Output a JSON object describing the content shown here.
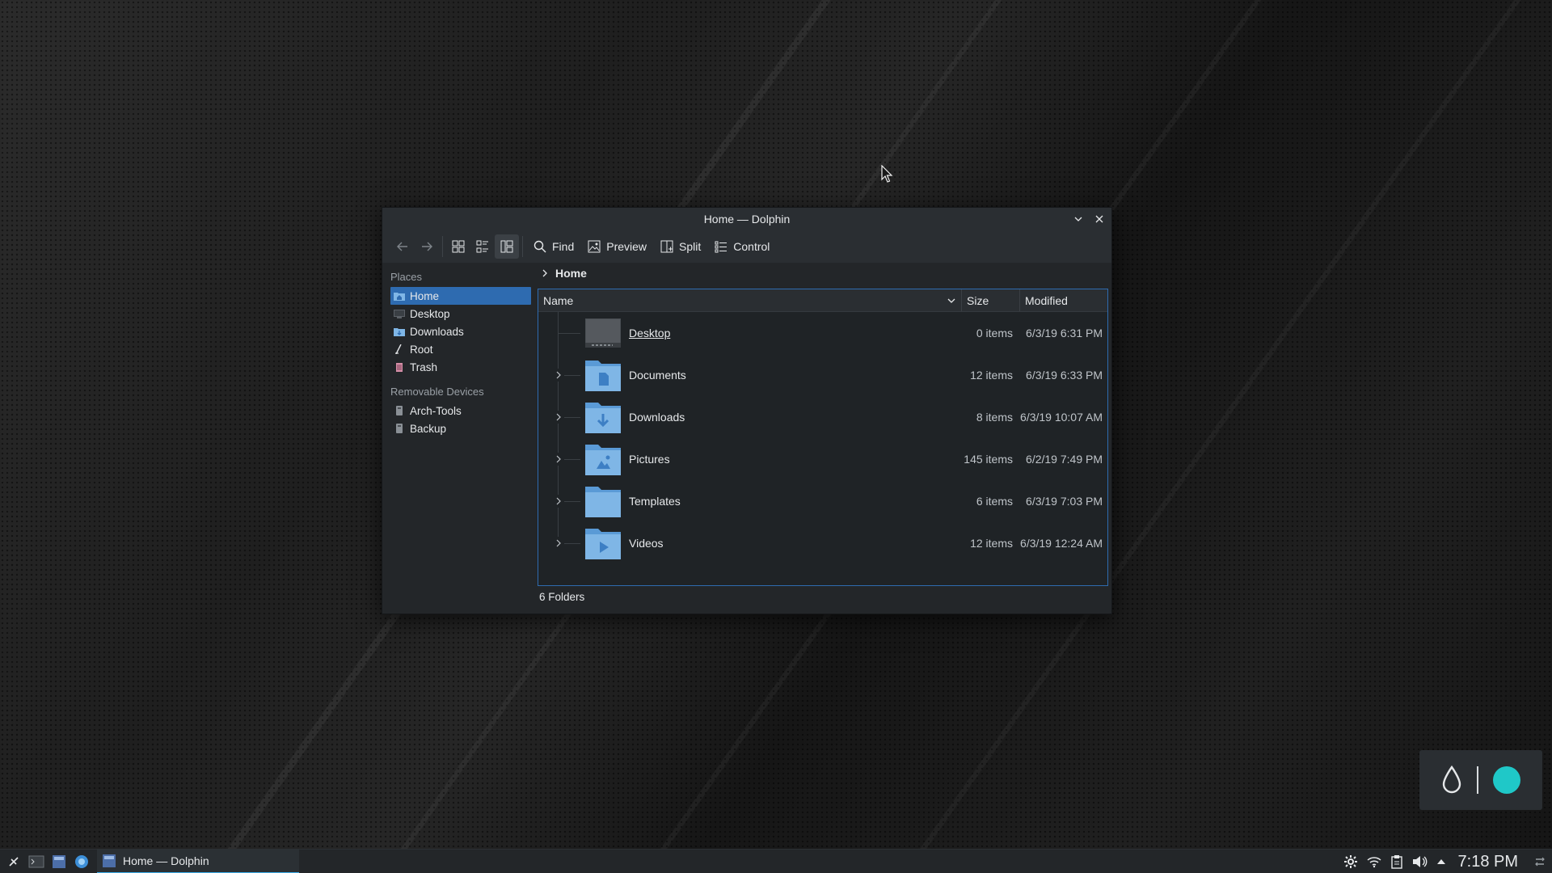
{
  "window": {
    "title": "Home — Dolphin"
  },
  "toolbar": {
    "find_label": "Find",
    "preview_label": "Preview",
    "split_label": "Split",
    "control_label": "Control"
  },
  "sidebar": {
    "places_title": "Places",
    "places": [
      {
        "label": "Home",
        "icon": "home-folder-icon",
        "selected": true
      },
      {
        "label": "Desktop",
        "icon": "desktop-icon"
      },
      {
        "label": "Downloads",
        "icon": "downloads-folder-icon"
      },
      {
        "label": "Root",
        "icon": "root-icon"
      },
      {
        "label": "Trash",
        "icon": "trash-icon"
      }
    ],
    "devices_title": "Removable Devices",
    "devices": [
      {
        "label": "Arch-Tools",
        "icon": "drive-icon"
      },
      {
        "label": "Backup",
        "icon": "drive-icon"
      }
    ]
  },
  "breadcrumb": {
    "current": "Home"
  },
  "columns": {
    "name": "Name",
    "size": "Size",
    "modified": "Modified"
  },
  "files": [
    {
      "name": "Desktop",
      "size": "0 items",
      "modified": "6/3/19 6:31 PM",
      "icon": "desktop-folder-icon"
    },
    {
      "name": "Documents",
      "size": "12 items",
      "modified": "6/3/19 6:33 PM",
      "icon": "documents-folder-icon"
    },
    {
      "name": "Downloads",
      "size": "8 items",
      "modified": "6/3/19 10:07 AM",
      "icon": "downloads-folder-icon"
    },
    {
      "name": "Pictures",
      "size": "145 items",
      "modified": "6/2/19 7:49 PM",
      "icon": "pictures-folder-icon"
    },
    {
      "name": "Templates",
      "size": "6 items",
      "modified": "6/3/19 7:03 PM",
      "icon": "templates-folder-icon"
    },
    {
      "name": "Videos",
      "size": "12 items",
      "modified": "6/3/19 12:24 AM",
      "icon": "videos-folder-icon"
    }
  ],
  "status": {
    "text": "6 Folders"
  },
  "taskbar": {
    "task_label": "Home — Dolphin",
    "clock": "7:18 PM"
  },
  "colors": {
    "accent": "#2e6bb0",
    "highlight": "#3daee9",
    "folder": "#7fb6e6",
    "widget_dot": "#1fc8c8"
  }
}
